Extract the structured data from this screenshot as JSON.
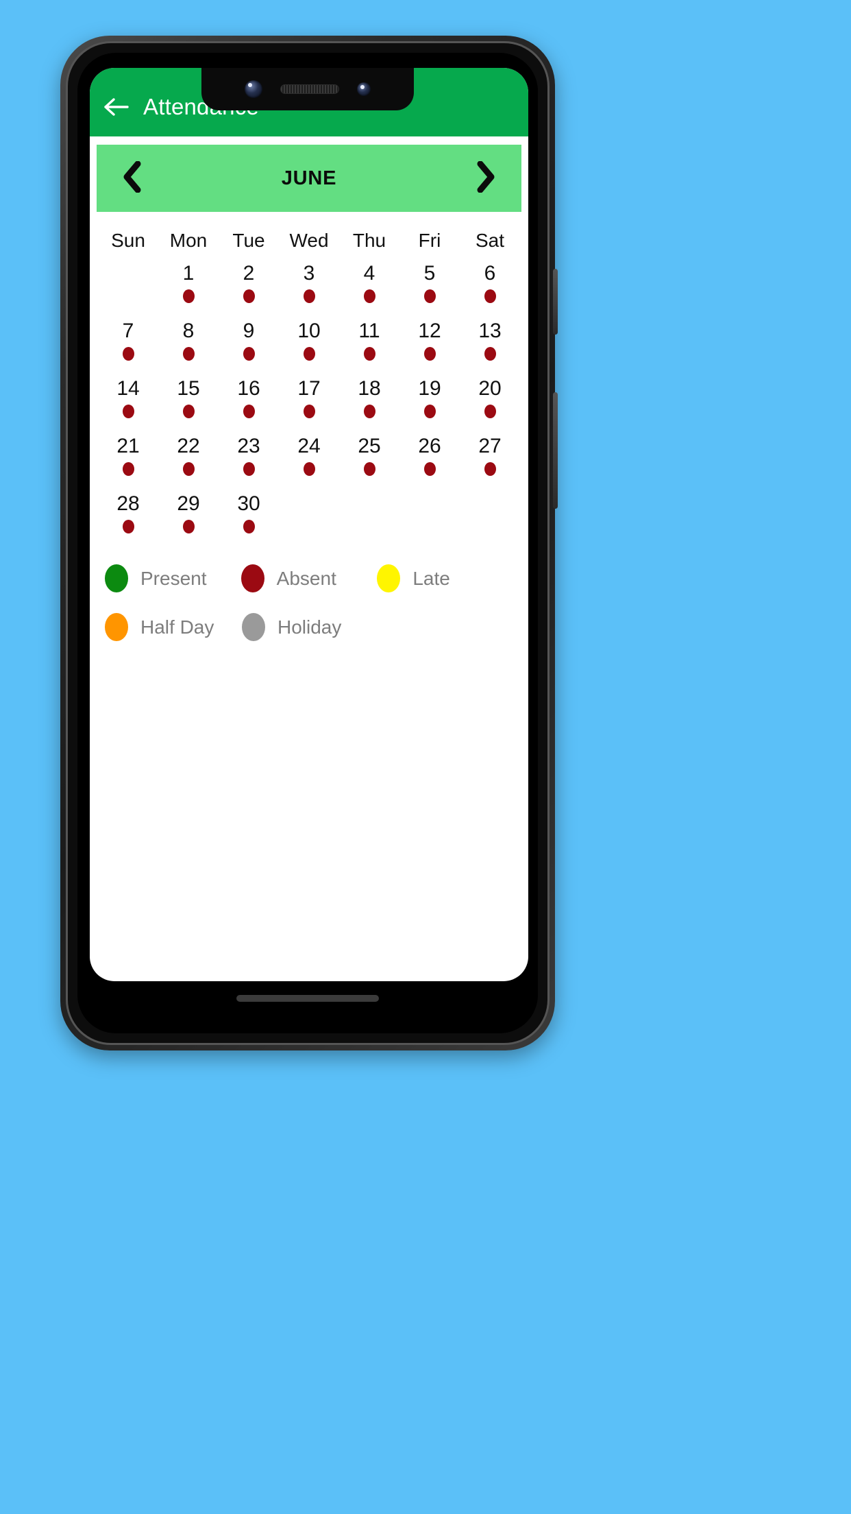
{
  "app": {
    "title": "Attendance",
    "back_icon": "arrow-left-icon",
    "header_color": "#06A94D"
  },
  "month_selector": {
    "prev_icon": "chevron-left-icon",
    "next_icon": "chevron-right-icon",
    "month": "JUNE",
    "bar_color": "#63DE82"
  },
  "calendar": {
    "weekdays": [
      "Sun",
      "Mon",
      "Tue",
      "Wed",
      "Thu",
      "Fri",
      "Sat"
    ],
    "leading_blanks": 1,
    "days": [
      {
        "num": "1",
        "status": "Absent"
      },
      {
        "num": "2",
        "status": "Absent"
      },
      {
        "num": "3",
        "status": "Absent"
      },
      {
        "num": "4",
        "status": "Absent"
      },
      {
        "num": "5",
        "status": "Absent"
      },
      {
        "num": "6",
        "status": "Absent"
      },
      {
        "num": "7",
        "status": "Absent"
      },
      {
        "num": "8",
        "status": "Absent"
      },
      {
        "num": "9",
        "status": "Absent"
      },
      {
        "num": "10",
        "status": "Absent"
      },
      {
        "num": "11",
        "status": "Absent"
      },
      {
        "num": "12",
        "status": "Absent"
      },
      {
        "num": "13",
        "status": "Absent"
      },
      {
        "num": "14",
        "status": "Absent"
      },
      {
        "num": "15",
        "status": "Absent"
      },
      {
        "num": "16",
        "status": "Absent"
      },
      {
        "num": "17",
        "status": "Absent"
      },
      {
        "num": "18",
        "status": "Absent"
      },
      {
        "num": "19",
        "status": "Absent"
      },
      {
        "num": "20",
        "status": "Absent"
      },
      {
        "num": "21",
        "status": "Absent"
      },
      {
        "num": "22",
        "status": "Absent"
      },
      {
        "num": "23",
        "status": "Absent"
      },
      {
        "num": "24",
        "status": "Absent"
      },
      {
        "num": "25",
        "status": "Absent"
      },
      {
        "num": "26",
        "status": "Absent"
      },
      {
        "num": "27",
        "status": "Absent"
      },
      {
        "num": "28",
        "status": "Absent"
      },
      {
        "num": "29",
        "status": "Absent"
      },
      {
        "num": "30",
        "status": "Absent"
      }
    ]
  },
  "legend": {
    "rows": [
      [
        {
          "label": "Present",
          "color": "#0C8A10"
        },
        {
          "label": "Absent",
          "color": "#9B0A12"
        },
        {
          "label": "Late",
          "color": "#FFF500"
        }
      ],
      [
        {
          "label": "Half Day",
          "color": "#FF9500"
        },
        {
          "label": "Holiday",
          "color": "#9A9A9A"
        }
      ]
    ]
  },
  "status_colors": {
    "Present": "#0C8A10",
    "Absent": "#9B0A12",
    "Late": "#FFF500",
    "Half Day": "#FF9500",
    "Holiday": "#9A9A9A"
  }
}
